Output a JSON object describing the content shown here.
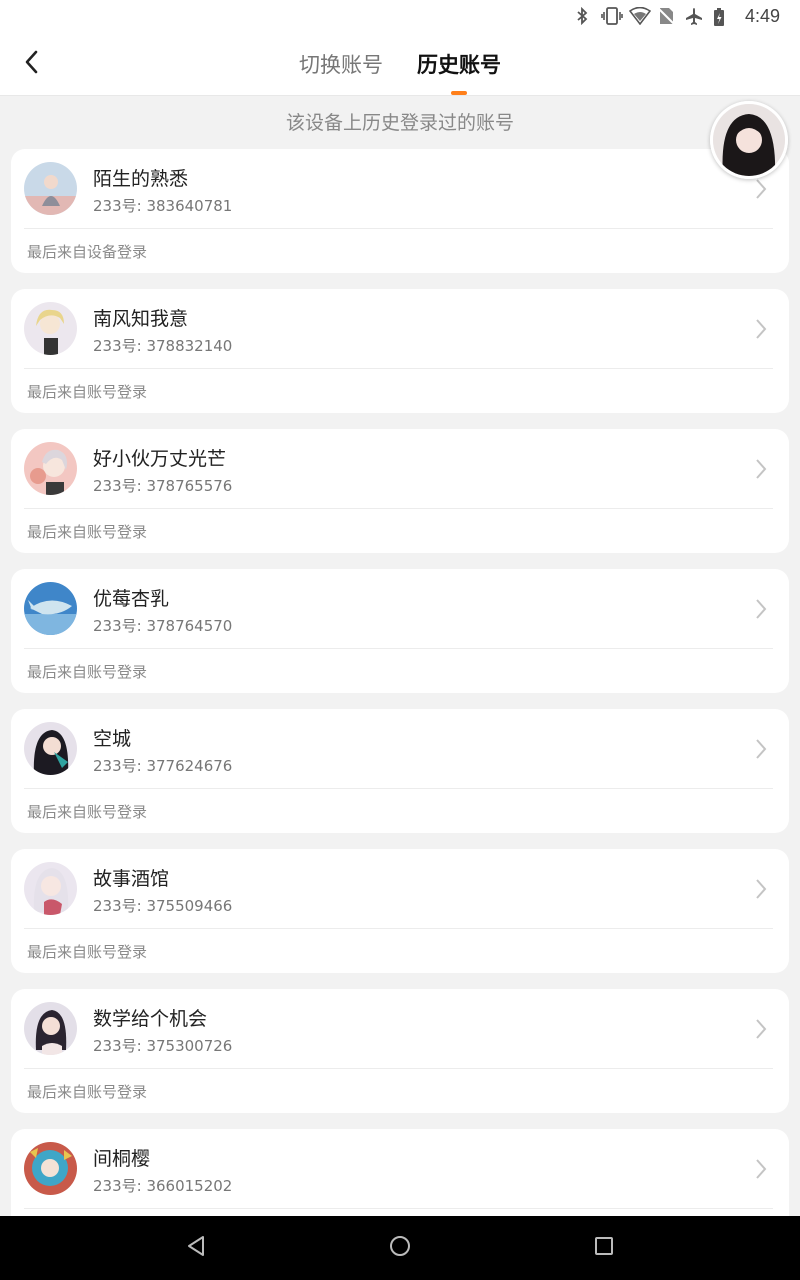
{
  "status_bar": {
    "time": "4:49",
    "icons": [
      "bluetooth-icon",
      "vibrate-icon",
      "wifi-icon",
      "no-sim-icon",
      "airplane-icon",
      "battery-icon"
    ]
  },
  "header": {
    "back_icon": "chevron-left-icon",
    "tabs": [
      {
        "label": "切换账号",
        "active": false
      },
      {
        "label": "历史账号",
        "active": true
      }
    ],
    "accent_color": "#ff7f1a"
  },
  "subtitle": "该设备上历史登录过的账号",
  "accounts": [
    {
      "name": "陌生的熟悉",
      "uid": "233号: 383640781",
      "source": "最后来自设备登录"
    },
    {
      "name": "南风知我意",
      "uid": "233号: 378832140",
      "source": "最后来自账号登录"
    },
    {
      "name": "好小伙万丈光芒",
      "uid": "233号: 378765576",
      "source": "最后来自账号登录"
    },
    {
      "name": "优莓杏乳",
      "uid": "233号: 378764570",
      "source": "最后来自账号登录"
    },
    {
      "name": "空城",
      "uid": "233号: 377624676",
      "source": "最后来自账号登录"
    },
    {
      "name": "故事酒馆",
      "uid": "233号: 375509466",
      "source": "最后来自账号登录"
    },
    {
      "name": "数学给个机会",
      "uid": "233号: 375300726",
      "source": "最后来自账号登录"
    },
    {
      "name": "间桐樱",
      "uid": "233号: 366015202",
      "source": ""
    }
  ],
  "nav_bar": {
    "icons": [
      "back-triangle-icon",
      "home-circle-icon",
      "recents-square-icon"
    ]
  }
}
